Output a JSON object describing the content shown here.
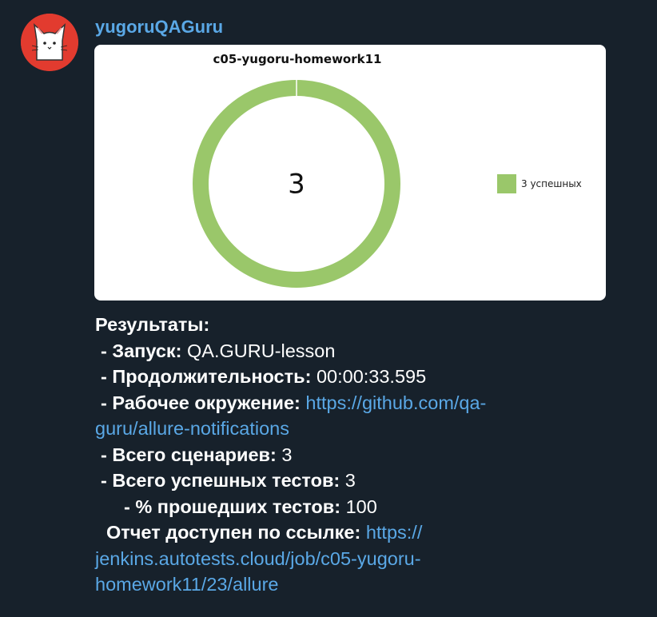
{
  "sender": {
    "name": "yugoruQAGuru",
    "avatar_icon": "white-cat-avatar-icon"
  },
  "colors": {
    "background": "#17212b",
    "link": "#5aa8e6",
    "passed": "#9ac76a"
  },
  "chart_data": {
    "type": "pie",
    "title": "c05-yugoru-homework11",
    "center_label": "3",
    "slices": [
      {
        "name": "3 успешных",
        "value": 3,
        "color": "#9ac76a"
      }
    ],
    "legend_position": "right"
  },
  "message": {
    "heading": "Результаты:",
    "launch_label": " - Запуск:",
    "launch_value": " QA.GURU-lesson",
    "duration_label": " - Продолжительность:",
    "duration_value": " 00:00:33.595",
    "env_label": " - Рабочее окружение:",
    "env_link_part1": "https://github.com/qa-",
    "env_link_part2": "guru/allure-notifications",
    "scenarios_label": " - Всего сценариев:",
    "scenarios_value": " 3",
    "passed_label": " - Всего успешных тестов:",
    "passed_value": " 3",
    "percent_label": " - % прошедших тестов:",
    "percent_value": " 100",
    "report_label": " Отчет доступен по ссылке:",
    "report_link_part1": "https://",
    "report_link_part2": "jenkins.autotests.cloud/job/c05-yugoru-",
    "report_link_part3": "homework11/23/allure"
  }
}
